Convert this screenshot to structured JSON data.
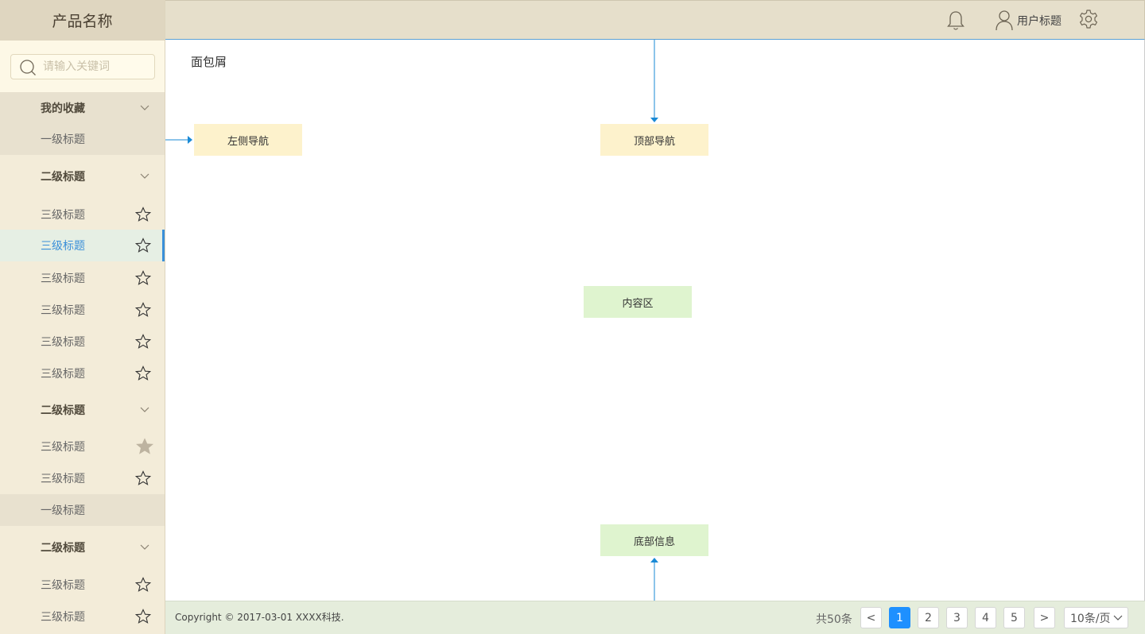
{
  "sidebar": {
    "brand": "产品名称",
    "search_placeholder": "请输入关键词",
    "items": [
      {
        "label": "我的收藏"
      },
      {
        "label": "一级标题"
      },
      {
        "label": "二级标题"
      },
      {
        "label": "三级标题",
        "starred": false
      },
      {
        "label": "三级标题",
        "starred": false,
        "active": true
      },
      {
        "label": "三级标题",
        "starred": false
      },
      {
        "label": "三级标题",
        "starred": false
      },
      {
        "label": "三级标题",
        "starred": false
      },
      {
        "label": "三级标题",
        "starred": false
      },
      {
        "label": "二级标题"
      },
      {
        "label": "三级标题",
        "starred": true
      },
      {
        "label": "三级标题",
        "starred": false
      },
      {
        "label": "一级标题"
      },
      {
        "label": "二级标题"
      },
      {
        "label": "三级标题",
        "starred": false
      },
      {
        "label": "三级标题",
        "starred": false
      }
    ]
  },
  "header": {
    "user_title": "用户标题",
    "icons": [
      "bell-icon",
      "user-icon",
      "gear-icon"
    ]
  },
  "main": {
    "breadcrumb": "面包屑",
    "annotations": {
      "left_nav": "左侧导航",
      "top_nav": "顶部导航",
      "content": "内容区",
      "footer_info": "底部信息"
    }
  },
  "footer": {
    "copyright": "Copyright © 2017-03-01 XXXX科技.",
    "total": "共50条",
    "prev": "<",
    "next": ">",
    "pages": [
      "1",
      "2",
      "3",
      "4",
      "5"
    ],
    "current_page": "1",
    "page_size": "10条/页"
  },
  "colors": {
    "accent": "#1e90ff",
    "annotation_line": "#1a8ad6",
    "sidebar_bg": "#f3ecd9",
    "header_bg": "#e6dfcb",
    "footer_bg": "#e5eddc"
  }
}
